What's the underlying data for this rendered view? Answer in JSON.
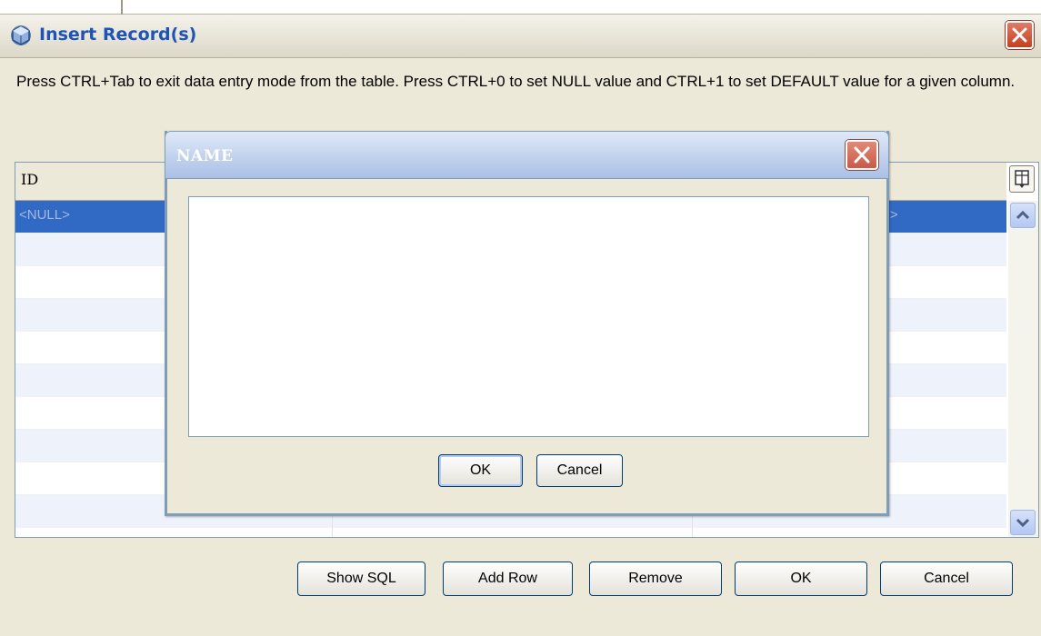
{
  "window": {
    "title": "Insert Record(s)",
    "instructions": "Press CTRL+Tab to exit data entry mode from the table. Press CTRL+0 to set NULL value and CTRL+1 to set DEFAULT value for a given column."
  },
  "table": {
    "columns": [
      "ID",
      "",
      ""
    ],
    "selected_row": {
      "cell_0": "<NULL>",
      "cell_2": "'>"
    },
    "row_count": 10
  },
  "buttons": {
    "show_sql": "Show SQL",
    "add_row": "Add Row",
    "remove": "Remove",
    "ok": "OK",
    "cancel": "Cancel"
  },
  "dialog": {
    "title": "NAME",
    "text_value": "",
    "ok": "OK",
    "cancel": "Cancel"
  },
  "colors": {
    "title_blue": "#1e54b8",
    "selection": "#316ac5",
    "close_red": "#c4401f"
  }
}
